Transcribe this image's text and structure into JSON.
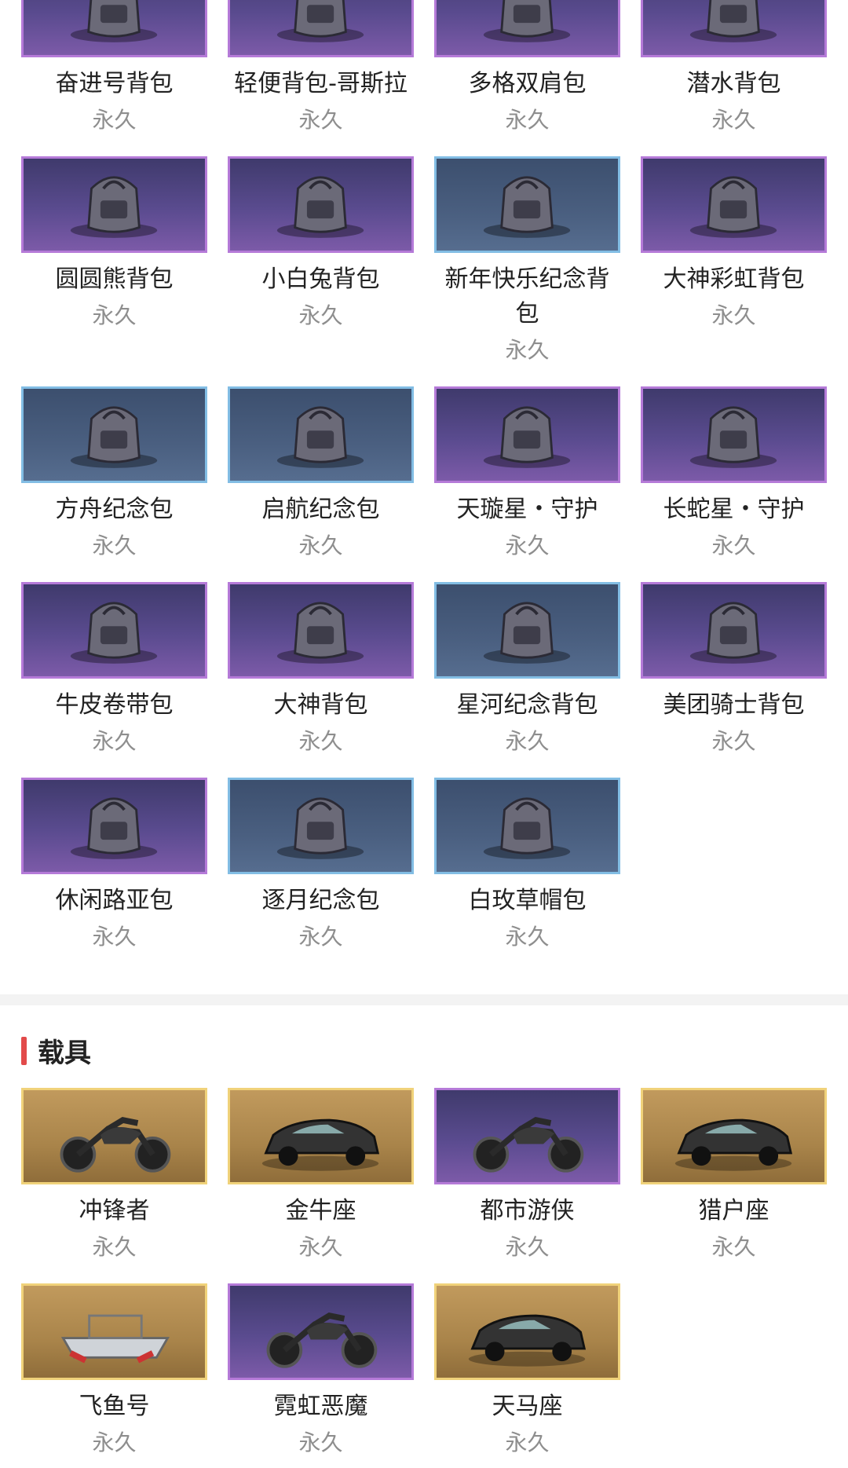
{
  "backpacks": [
    {
      "name": "奋进号背包",
      "duration": "永久",
      "style": "purple",
      "icon": "backpack-icon"
    },
    {
      "name": "轻便背包-哥斯拉",
      "duration": "永久",
      "style": "purple",
      "icon": "backpack-icon"
    },
    {
      "name": "多格双肩包",
      "duration": "永久",
      "style": "purple",
      "icon": "backpack-icon"
    },
    {
      "name": "潜水背包",
      "duration": "永久",
      "style": "purple",
      "icon": "backpack-icon"
    },
    {
      "name": "圆圆熊背包",
      "duration": "永久",
      "style": "purple",
      "icon": "backpack-icon"
    },
    {
      "name": "小白兔背包",
      "duration": "永久",
      "style": "purple",
      "icon": "backpack-icon"
    },
    {
      "name": "新年快乐纪念背包",
      "duration": "永久",
      "style": "blue",
      "icon": "backpack-icon"
    },
    {
      "name": "大神彩虹背包",
      "duration": "永久",
      "style": "purple",
      "icon": "backpack-icon"
    },
    {
      "name": "方舟纪念包",
      "duration": "永久",
      "style": "blue",
      "icon": "backpack-icon"
    },
    {
      "name": "启航纪念包",
      "duration": "永久",
      "style": "blue",
      "icon": "backpack-icon"
    },
    {
      "name": "天璇星・守护",
      "duration": "永久",
      "style": "purple",
      "icon": "backpack-icon"
    },
    {
      "name": "长蛇星・守护",
      "duration": "永久",
      "style": "purple",
      "icon": "backpack-icon"
    },
    {
      "name": "牛皮卷带包",
      "duration": "永久",
      "style": "purple",
      "icon": "backpack-icon"
    },
    {
      "name": "大神背包",
      "duration": "永久",
      "style": "purple",
      "icon": "backpack-icon"
    },
    {
      "name": "星河纪念背包",
      "duration": "永久",
      "style": "blue",
      "icon": "backpack-icon"
    },
    {
      "name": "美团骑士背包",
      "duration": "永久",
      "style": "purple",
      "icon": "backpack-icon"
    },
    {
      "name": "休闲路亚包",
      "duration": "永久",
      "style": "purple",
      "icon": "backpack-icon"
    },
    {
      "name": "逐月纪念包",
      "duration": "永久",
      "style": "blue",
      "icon": "backpack-icon"
    },
    {
      "name": "白玫草帽包",
      "duration": "永久",
      "style": "blue",
      "icon": "backpack-icon"
    }
  ],
  "vehicles_section": {
    "title": "载具"
  },
  "vehicles": [
    {
      "name": "冲锋者",
      "duration": "永久",
      "style": "gold",
      "icon": "motorcycle-icon"
    },
    {
      "name": "金牛座",
      "duration": "永久",
      "style": "gold",
      "icon": "car-icon"
    },
    {
      "name": "都市游侠",
      "duration": "永久",
      "style": "purple",
      "icon": "motorcycle-icon"
    },
    {
      "name": "猎户座",
      "duration": "永久",
      "style": "gold",
      "icon": "car-icon"
    },
    {
      "name": "飞鱼号",
      "duration": "永久",
      "style": "gold",
      "icon": "boat-icon"
    },
    {
      "name": "霓虹恶魔",
      "duration": "永久",
      "style": "purple",
      "icon": "motorcycle-icon"
    },
    {
      "name": "天马座",
      "duration": "永久",
      "style": "gold",
      "icon": "car-icon"
    }
  ],
  "colors": {
    "purple_border": "#b57ad8",
    "blue_border": "#82bde4",
    "gold_border": "#f0d27a",
    "accent_bar": "#e24a4a"
  }
}
